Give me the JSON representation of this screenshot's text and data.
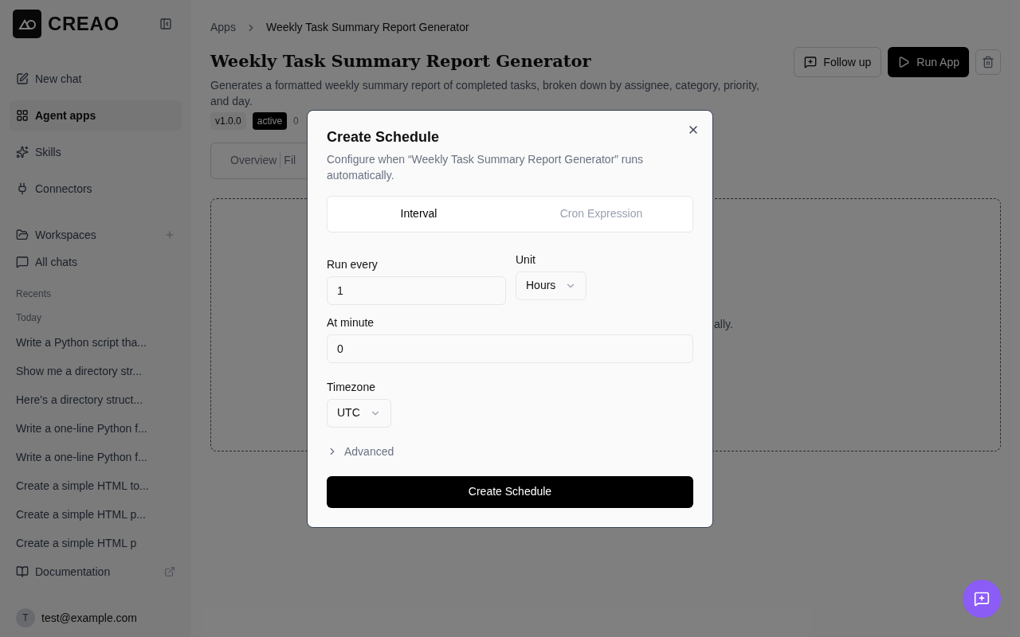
{
  "sidebar": {
    "logo_text": "CREAO",
    "nav": [
      {
        "label": "New chat",
        "selected": false
      },
      {
        "label": "Agent apps",
        "selected": true
      },
      {
        "label": "Skills",
        "selected": false
      },
      {
        "label": "Connectors",
        "selected": false
      }
    ],
    "workspaces": "Workspaces",
    "all_chats": "All chats",
    "recents_label": "Recents",
    "today_label": "Today",
    "recents": [
      "Write a Python script tha...",
      "Show me a directory str...",
      "Here's a directory struct...",
      "Write a one-line Python f...",
      "Write a one-line Python f...",
      "Create a simple HTML to...",
      "Create a simple HTML p...",
      "Create a simple HTML p"
    ],
    "documentation": "Documentation",
    "user": {
      "initial": "T",
      "email": "test@example.com"
    }
  },
  "breadcrumb": [
    "Apps",
    "Weekly Task Summary Report Generator"
  ],
  "app": {
    "title": "Weekly Task Summary Report Generator",
    "description": "Generates a formatted weekly summary report of completed tasks, broken down by assignee, category, priority, and day.",
    "version": "v1.0.0",
    "status": "active",
    "count": "0"
  },
  "actions": {
    "follow_up": "Follow up",
    "run": "Run App"
  },
  "tabs": [
    {
      "label": "Overview",
      "selected": false
    },
    {
      "label": "Fil",
      "selected": false
    }
  ],
  "empty_text": "ally.",
  "dialog": {
    "title": "Create Schedule",
    "description": "Configure when “Weekly Task Summary Report Generator” runs automatically.",
    "modes": [
      {
        "label": "Interval",
        "selected": true
      },
      {
        "label": "Cron Expression",
        "selected": false
      }
    ],
    "run_every": {
      "label": "Run every",
      "value": "1"
    },
    "unit": {
      "label": "Unit",
      "value": "Hours"
    },
    "at_minute": {
      "label": "At minute",
      "value": "0"
    },
    "timezone": {
      "label": "Timezone",
      "value": "UTC"
    },
    "advanced": {
      "label": "Advanced",
      "expanded": false
    },
    "submit": "Create Schedule"
  }
}
